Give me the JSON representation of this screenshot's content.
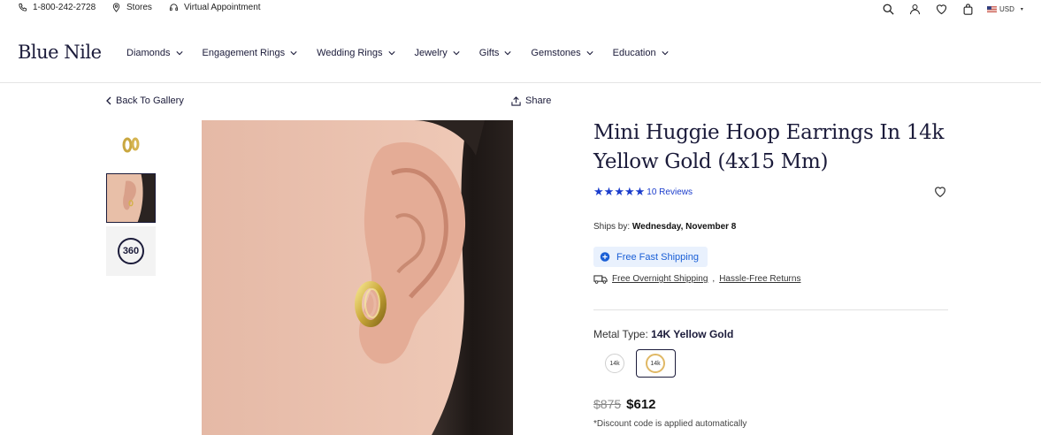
{
  "utility_bar": {
    "phone": "1-800-242-2728",
    "stores": "Stores",
    "virtual": "Virtual Appointment",
    "currency": "USD"
  },
  "brand": {
    "logo": "Blue Nile"
  },
  "nav": {
    "items": [
      {
        "label": "Diamonds"
      },
      {
        "label": "Engagement Rings"
      },
      {
        "label": "Wedding Rings"
      },
      {
        "label": "Jewelry"
      },
      {
        "label": "Gifts"
      },
      {
        "label": "Gemstones"
      },
      {
        "label": "Education"
      }
    ]
  },
  "gallery": {
    "back_label": "Back To Gallery",
    "share_label": "Share",
    "badge_360": "360"
  },
  "product": {
    "title": "Mini Huggie Hoop Earrings In 14k Yellow Gold (4x15 Mm)",
    "rating_stars": 5,
    "reviews": "10 Reviews",
    "ships_label": "Ships by:",
    "ships_date": "Wednesday, November 8",
    "free_shipping": "Free Fast Shipping",
    "overnight": "Free Overnight Shipping",
    "returns": "Hassle-Free Returns",
    "metal_label": "Metal Type:",
    "metal_value": "14K Yellow Gold",
    "swatch_1": "14k",
    "swatch_2": "14k",
    "price_old": "$875",
    "price_new": "$612",
    "discount_note": "*Discount code is applied automatically"
  },
  "colors": {
    "navy": "#1b1b3a",
    "link_blue": "#1a3ccc",
    "shipping_bg": "#e9f1fd",
    "gold": "#e0b865"
  }
}
